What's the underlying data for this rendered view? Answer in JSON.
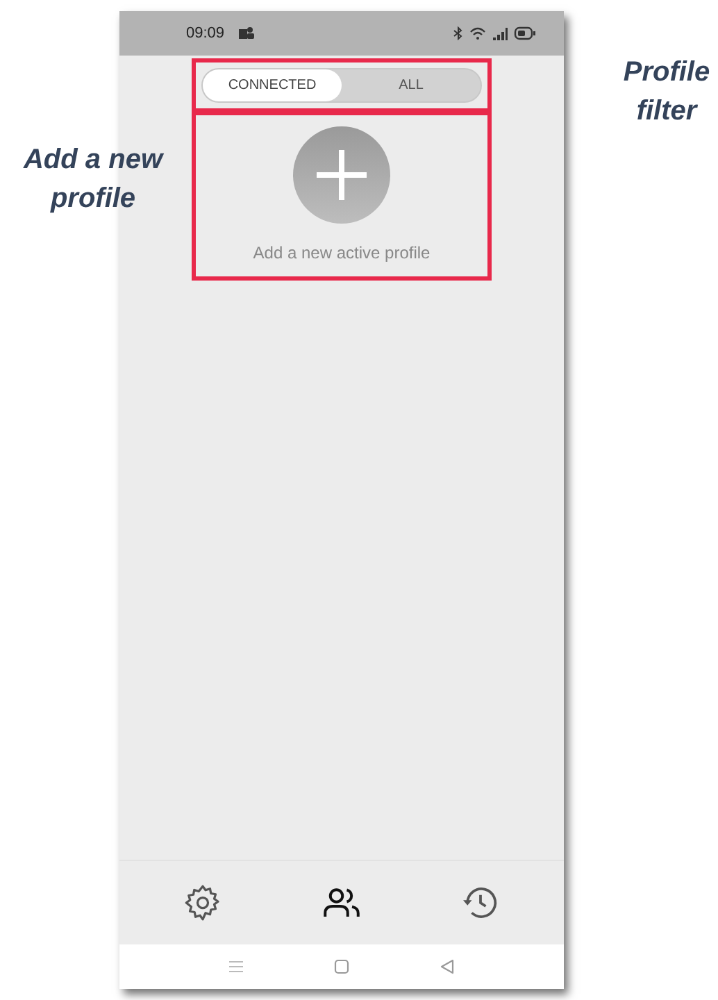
{
  "status_bar": {
    "time": "09:09"
  },
  "profile_filter": {
    "tabs": [
      {
        "label": "CONNECTED",
        "selected": true
      },
      {
        "label": "ALL",
        "selected": false
      }
    ]
  },
  "add_profile": {
    "label": "Add a new active profile"
  },
  "bottom_nav": [
    {
      "kind": "settings",
      "selected": false
    },
    {
      "kind": "profiles",
      "selected": true
    },
    {
      "kind": "history",
      "selected": false
    }
  ],
  "annotations": [
    {
      "kind": "left",
      "text": "Add a new profile"
    },
    {
      "kind": "right",
      "text": "Profile filter"
    }
  ]
}
